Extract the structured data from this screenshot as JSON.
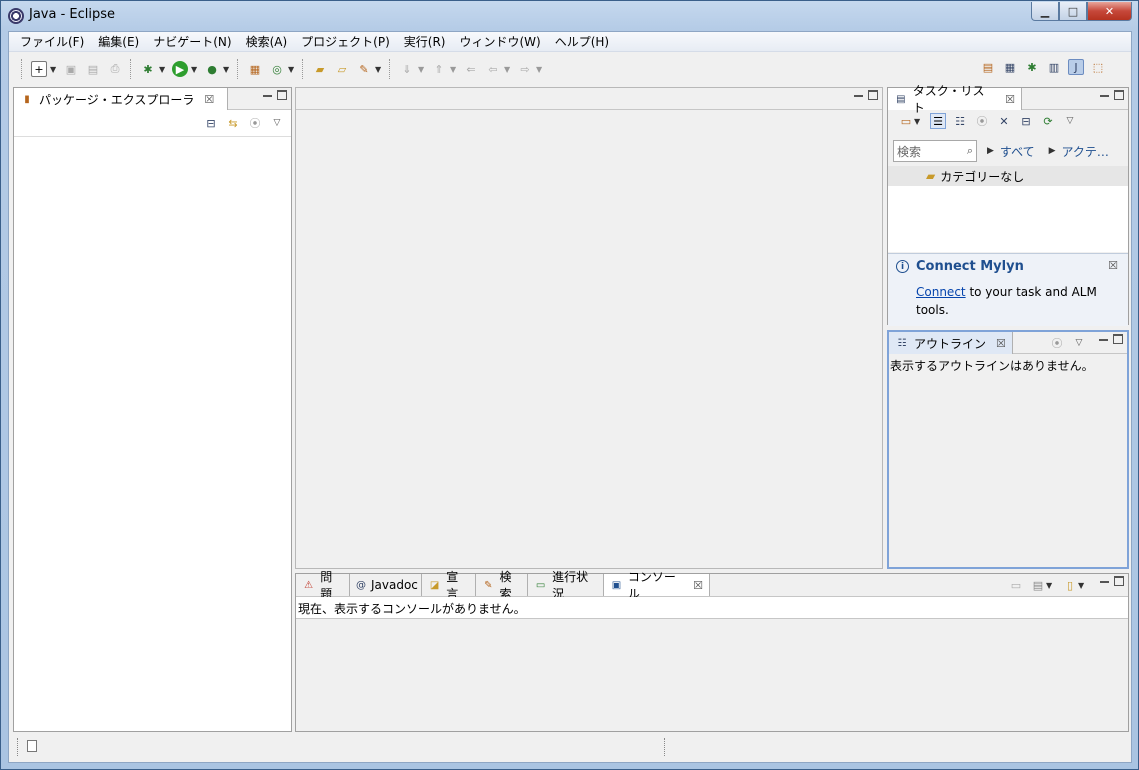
{
  "window": {
    "title": "Java - Eclipse"
  },
  "menu": {
    "items": [
      "ファイル(F)",
      "編集(E)",
      "ナビゲート(N)",
      "検索(A)",
      "プロジェクト(P)",
      "実行(R)",
      "ウィンドウ(W)",
      "ヘルプ(H)"
    ]
  },
  "package_explorer": {
    "title": "パッケージ・エクスプローラ"
  },
  "task_list": {
    "title": "タスク・リスト",
    "search_placeholder": "検索",
    "filter_all": "すべて",
    "filter_active": "アクテ…",
    "category": "カテゴリーなし"
  },
  "mylyn": {
    "title": "Connect Mylyn",
    "link": "Connect",
    "text": " to your task and ALM tools."
  },
  "outline": {
    "title": "アウトライン",
    "empty_text": "表示するアウトラインはありません。"
  },
  "bottom_tabs": [
    "問題",
    "Javadoc",
    "宣言",
    "検索",
    "進行状況",
    "コンソール"
  ],
  "console": {
    "empty_text": "現在、表示するコンソールがありません。"
  },
  "colors": {
    "accent_blue": "#1f4f8f",
    "selection_border": "#7fa3d8"
  }
}
